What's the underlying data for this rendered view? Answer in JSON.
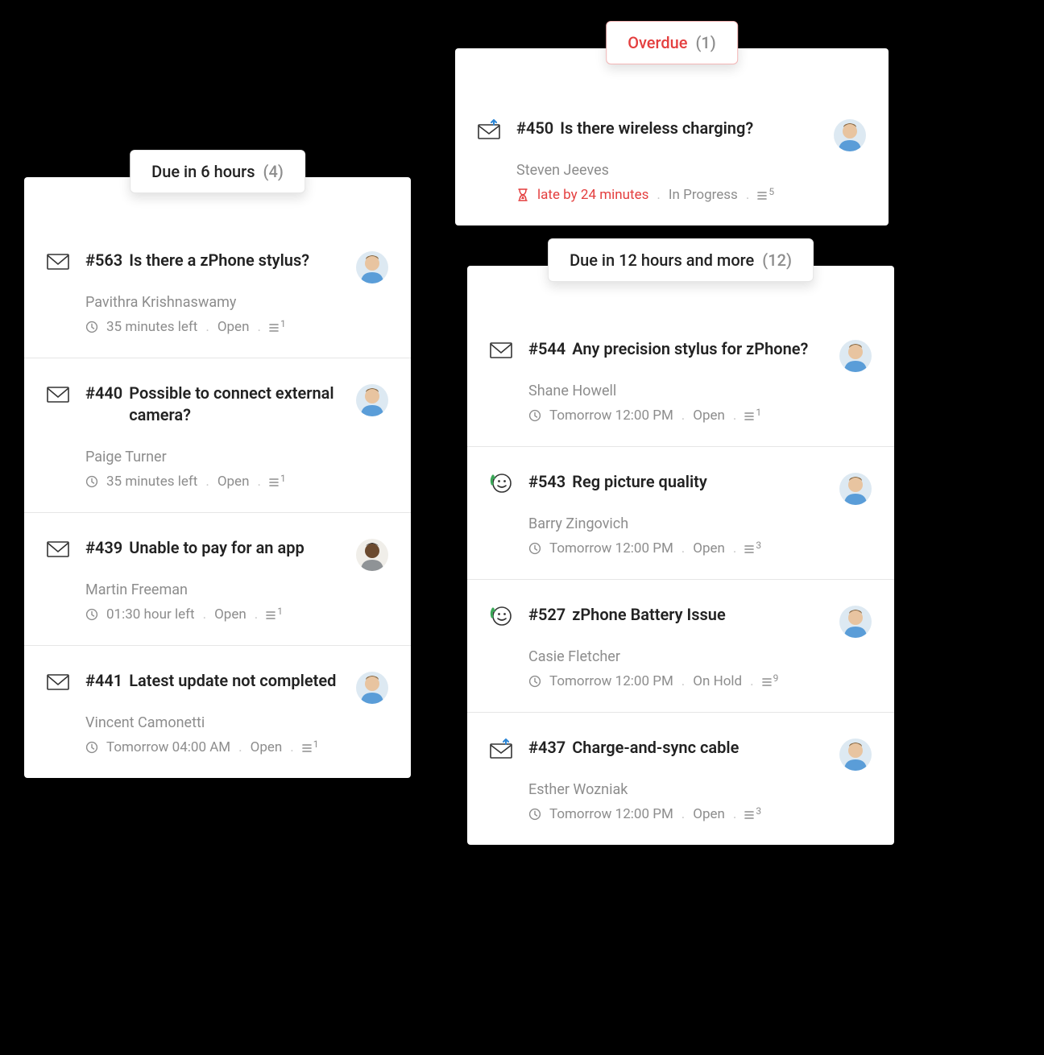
{
  "columns": {
    "left": {
      "label": "Due in 6 hours",
      "count": "(4)",
      "tickets": [
        {
          "id": "#563",
          "title": "Is there a zPhone stylus?",
          "requester": "Pavithra Krishnaswamy",
          "due": "35 minutes left",
          "status": "Open",
          "threads": "1",
          "channel": "email",
          "avatar": "a1"
        },
        {
          "id": "#440",
          "title": "Possible to connect external camera?",
          "requester": "Paige Turner",
          "due": "35 minutes left",
          "status": "Open",
          "threads": "1",
          "channel": "email",
          "avatar": "a1"
        },
        {
          "id": "#439",
          "title": "Unable to pay for an app",
          "requester": "Martin Freeman",
          "due": "01:30 hour left",
          "status": "Open",
          "threads": "1",
          "channel": "email",
          "avatar": "a2"
        },
        {
          "id": "#441",
          "title": "Latest update not completed",
          "requester": "Vincent Camonetti",
          "due": "Tomorrow 04:00 AM",
          "status": "Open",
          "threads": "1",
          "channel": "email",
          "avatar": "a1"
        }
      ]
    },
    "overdue": {
      "label": "Overdue",
      "count": "(1)",
      "tickets": [
        {
          "id": "#450",
          "title": "Is there wireless charging?",
          "requester": "Steven Jeeves",
          "late": "late by 24 minutes",
          "status": "In Progress",
          "threads": "5",
          "channel": "email-reply",
          "avatar": "a1"
        }
      ]
    },
    "right": {
      "label": "Due in 12 hours and more",
      "count": "(12)",
      "tickets": [
        {
          "id": "#544",
          "title": "Any precision stylus for zPhone?",
          "requester": "Shane Howell",
          "due": "Tomorrow 12:00 PM",
          "status": "Open",
          "threads": "1",
          "channel": "email",
          "avatar": "a1"
        },
        {
          "id": "#543",
          "title": "Reg picture quality",
          "requester": "Barry Zingovich",
          "due": "Tomorrow 12:00 PM",
          "status": "Open",
          "threads": "3",
          "channel": "feedback",
          "avatar": "a1"
        },
        {
          "id": "#527",
          "title": "zPhone Battery Issue",
          "requester": "Casie Fletcher",
          "due": "Tomorrow 12:00 PM",
          "status": "On Hold",
          "threads": "9",
          "channel": "feedback",
          "avatar": "a1"
        },
        {
          "id": "#437",
          "title": "Charge-and-sync cable",
          "requester": "Esther Wozniak",
          "due": "Tomorrow 12:00 PM",
          "status": "Open",
          "threads": "3",
          "channel": "email-reply",
          "avatar": "a1"
        }
      ]
    }
  },
  "icons": {
    "dot": "."
  }
}
